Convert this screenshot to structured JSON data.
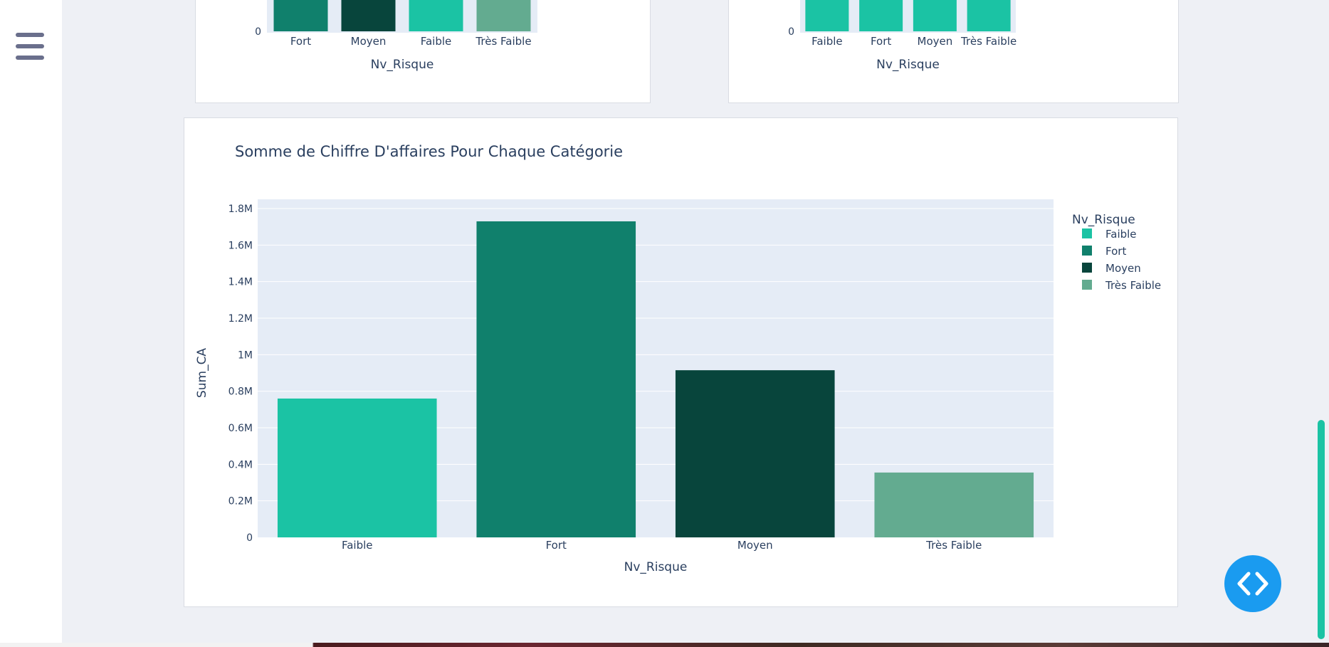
{
  "colors": {
    "Faible": "#1bc3a4",
    "Fort": "#10806c",
    "Moyen": "#08453c",
    "Très Faible": "#63ab90",
    "plot_bg": "#e5ecf6",
    "text": "#2a3f5f",
    "fab": "#1a9bf0",
    "scroll_thumb": "#1bc3a4"
  },
  "icons": {
    "menu": "hamburger-menu-icon",
    "code": "code-brackets-icon"
  },
  "chart_data": [
    {
      "type": "bar",
      "title": "",
      "categories": [
        "Fort",
        "Moyen",
        "Faible",
        "Très Faible"
      ],
      "xlabel": "Nv_Risque",
      "ylabel": "",
      "y_tick_labels": [
        "0"
      ],
      "note": "partially visible"
    },
    {
      "type": "bar",
      "title": "",
      "categories": [
        "Faible",
        "Fort",
        "Moyen",
        "Très Faible"
      ],
      "xlabel": "Nv_Risque",
      "ylabel": "",
      "y_tick_labels": [
        "0"
      ],
      "note": "partially visible"
    },
    {
      "type": "bar",
      "title": "Somme de Chiffre D'affaires Pour Chaque Catégorie",
      "categories": [
        "Faible",
        "Fort",
        "Moyen",
        "Très Faible"
      ],
      "values": [
        760000,
        1730000,
        915000,
        355000
      ],
      "xlabel": "Nv_Risque",
      "ylabel": "Sum_CA",
      "ylim": [
        0,
        1800000
      ],
      "y_ticks": [
        0,
        200000,
        400000,
        600000,
        800000,
        1000000,
        1200000,
        1400000,
        1600000,
        1800000
      ],
      "y_tick_labels": [
        "0",
        "0.2M",
        "0.4M",
        "0.6M",
        "0.8M",
        "1M",
        "1.2M",
        "1.4M",
        "1.6M",
        "1.8M"
      ],
      "legend_title": "Nv_Risque",
      "legend": [
        "Faible",
        "Fort",
        "Moyen",
        "Très Faible"
      ],
      "legend_position": "top-right",
      "grid": true
    }
  ]
}
